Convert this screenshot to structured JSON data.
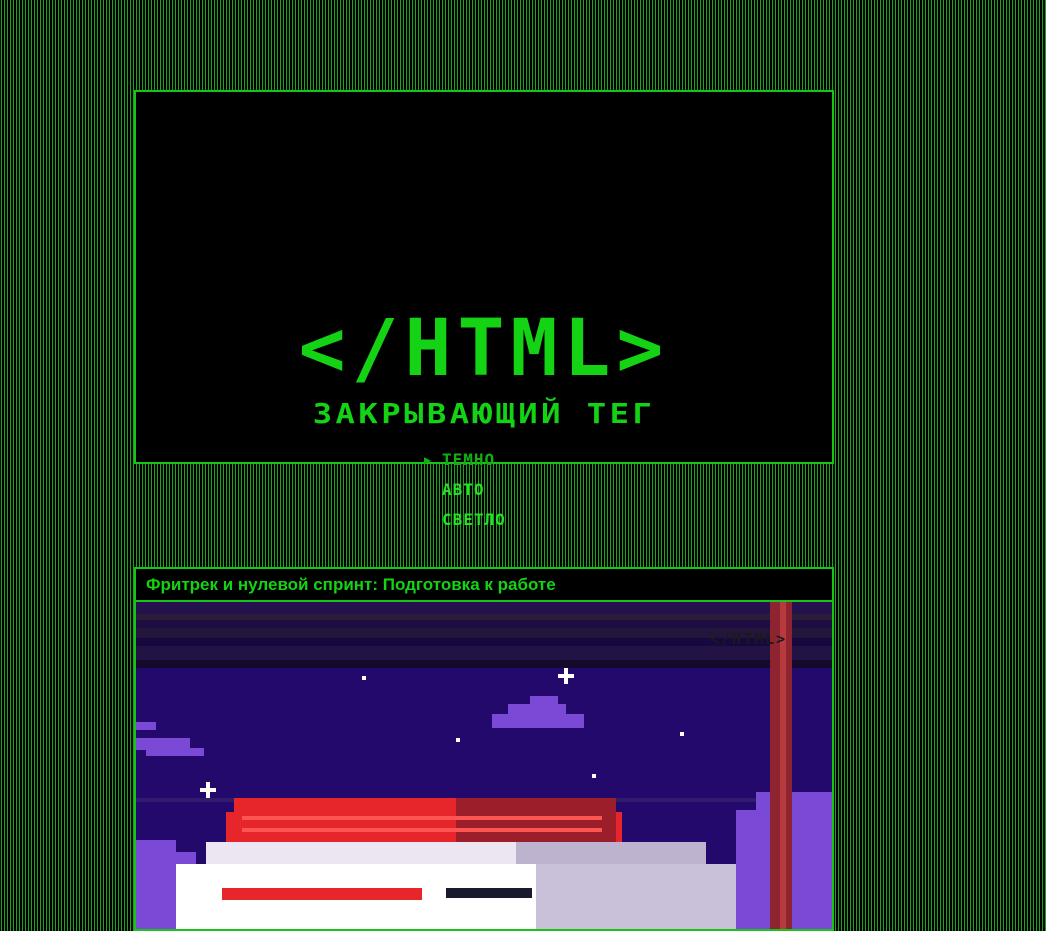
{
  "hero": {
    "logo_text": "</HTML>",
    "tagline": "ЗАКРЫВАЮЩИЙ ТЕГ",
    "theme_menu": {
      "selected": "ТЕМНО",
      "items": [
        "ТЕМНО",
        "АВТО",
        "СВЕТЛО"
      ]
    }
  },
  "card": {
    "title": "Фритрек и нулевой спринт: Подготовка к работе",
    "watermark_text": "</HTML>"
  },
  "colors": {
    "accent": "#14d214",
    "background": "#000000"
  }
}
